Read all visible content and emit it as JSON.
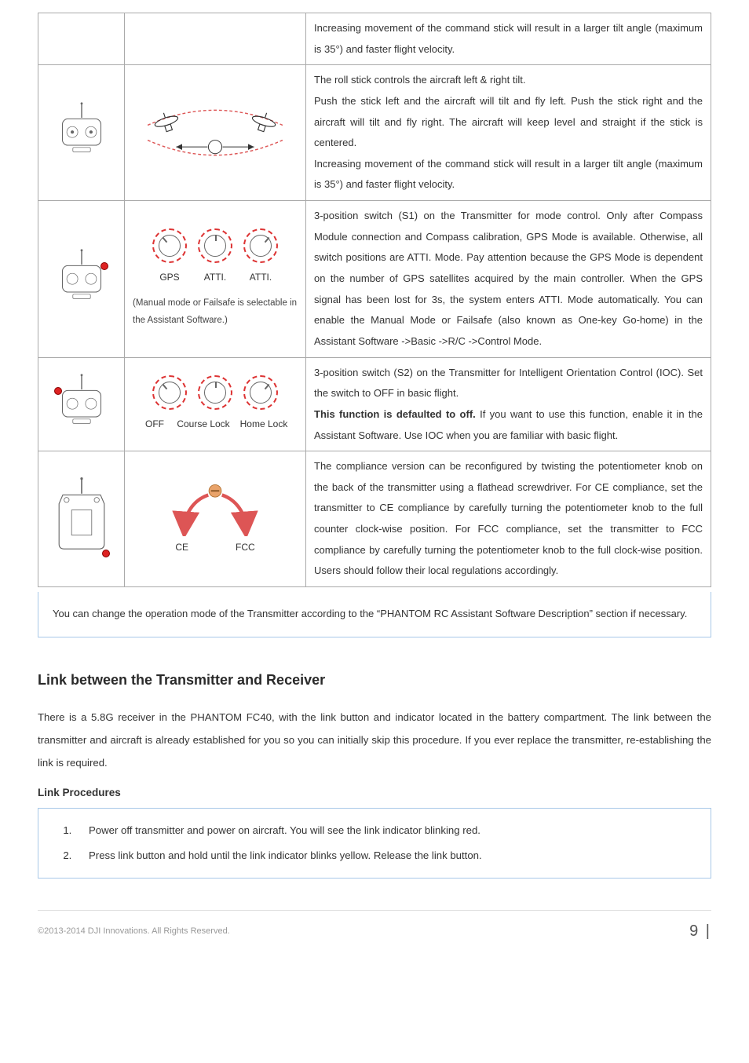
{
  "rows": {
    "r1": {
      "desc": "Increasing movement of the command stick will result in a larger tilt angle (maximum is 35°) and faster flight velocity."
    },
    "r2": {
      "desc": "The roll stick controls the aircraft left & right tilt.\nPush the stick left and the aircraft will tilt and fly left. Push the stick right and the aircraft will tilt and fly right. The aircraft will keep level and straight if the stick is centered.\nIncreasing movement of the command stick will result in a larger tilt angle (maximum is 35°) and faster flight velocity."
    },
    "r3": {
      "labels": [
        "GPS",
        "ATTI.",
        "ATTI."
      ],
      "subnote": "(Manual mode or Failsafe is selectable in the Assistant Software.)",
      "desc": "3-position switch (S1) on the Transmitter for mode control. Only after Compass Module connection and Compass calibration, GPS Mode is available. Otherwise, all switch positions are ATTI. Mode. Pay attention because the GPS Mode is dependent on the number of GPS satellites acquired by the main controller. When the GPS signal has been lost for 3s, the system enters ATTI. Mode automatically. You can enable the Manual Mode or Failsafe (also known as One-key Go-home) in the Assistant Software ->Basic ->R/C ->Control Mode."
    },
    "r4": {
      "labels": [
        "OFF",
        "Course Lock",
        "Home Lock"
      ],
      "desc_pre": "3-position switch (S2) on the Transmitter for Intelligent Orientation Control (IOC). Set the switch to OFF in basic flight.",
      "desc_bold": "This function is defaulted to off.",
      "desc_post": " If you want to use this function, enable it in the Assistant Software. Use IOC when you are familiar with basic flight."
    },
    "r5": {
      "labels": [
        "CE",
        "FCC"
      ],
      "desc": "The compliance version can be reconfigured by twisting the potentiometer knob on the back of the transmitter using a flathead screwdriver. For CE compliance, set the transmitter to CE compliance by carefully turning the potentiometer knob to the full counter clock-wise position. For FCC compliance, set the transmitter to FCC compliance by carefully turning the potentiometer knob to the full clock-wise position. Users should follow their local regulations accordingly."
    },
    "note": "You can change the operation mode of the Transmitter according to the “PHANTOM RC Assistant Software Description” section if necessary."
  },
  "section_title": "Link between the Transmitter and Receiver",
  "section_body": "There is a 5.8G receiver in the PHANTOM FC40, with the link button and indicator located in the battery compartment. The link between the transmitter and aircraft is already established for you so you can initially skip this procedure. If you ever replace the transmitter, re-establishing the link is required.",
  "procedures_title": "Link Procedures",
  "steps": [
    "Power off transmitter and power on aircraft. You will see the link indicator blinking red.",
    "Press link button and hold until the link indicator blinks yellow. Release the link button."
  ],
  "footer": {
    "copyright": "©2013-2014 DJI Innovations. All Rights Reserved.",
    "page": "9 |"
  }
}
